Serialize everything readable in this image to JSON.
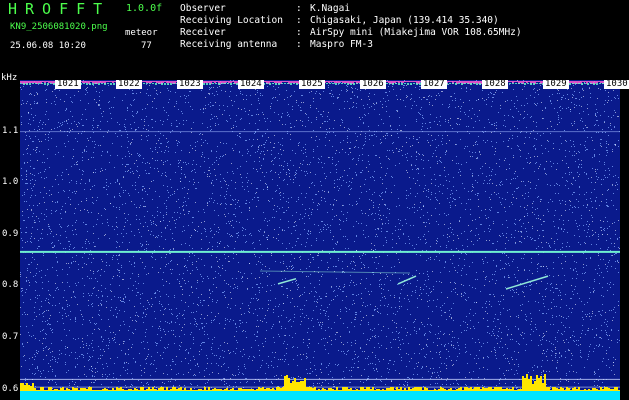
{
  "header": {
    "app_title": "HROFFT",
    "app_version": "1.0.0f",
    "file_name": "KN9_2506081020.png",
    "datetime": "25.06.08 10:20",
    "meteor_label": "meteor",
    "meteor_count": "77"
  },
  "info": [
    {
      "key": "Observer",
      "value": "K.Nagai"
    },
    {
      "key": "Receiving Location",
      "value": "Chigasaki, Japan (139.414 35.340)"
    },
    {
      "key": "Receiver",
      "value": "AirSpy mini (Miakejima VOR 108.65MHz)"
    },
    {
      "key": "Receiving antenna",
      "value": "Maspro FM-3"
    }
  ],
  "axis": {
    "y_unit": "kHz",
    "y_ticks": [
      "1.1",
      "1.0",
      "0.9",
      "0.8",
      "0.7",
      "0.6"
    ],
    "y_range": [
      0.58,
      1.2
    ],
    "time_ticks": [
      "1021",
      "1022",
      "1023",
      "1024",
      "1025",
      "1026",
      "1027",
      "1028",
      "1029",
      "1030"
    ]
  },
  "colors": {
    "background": "#0a1a8c",
    "noise_dot": "#7fa8ff",
    "carrier_line": "#6ff0d0",
    "meteor_echo": "#9fffe0",
    "bottom_band": "#00e5ff",
    "peak": "#ffe600"
  }
}
